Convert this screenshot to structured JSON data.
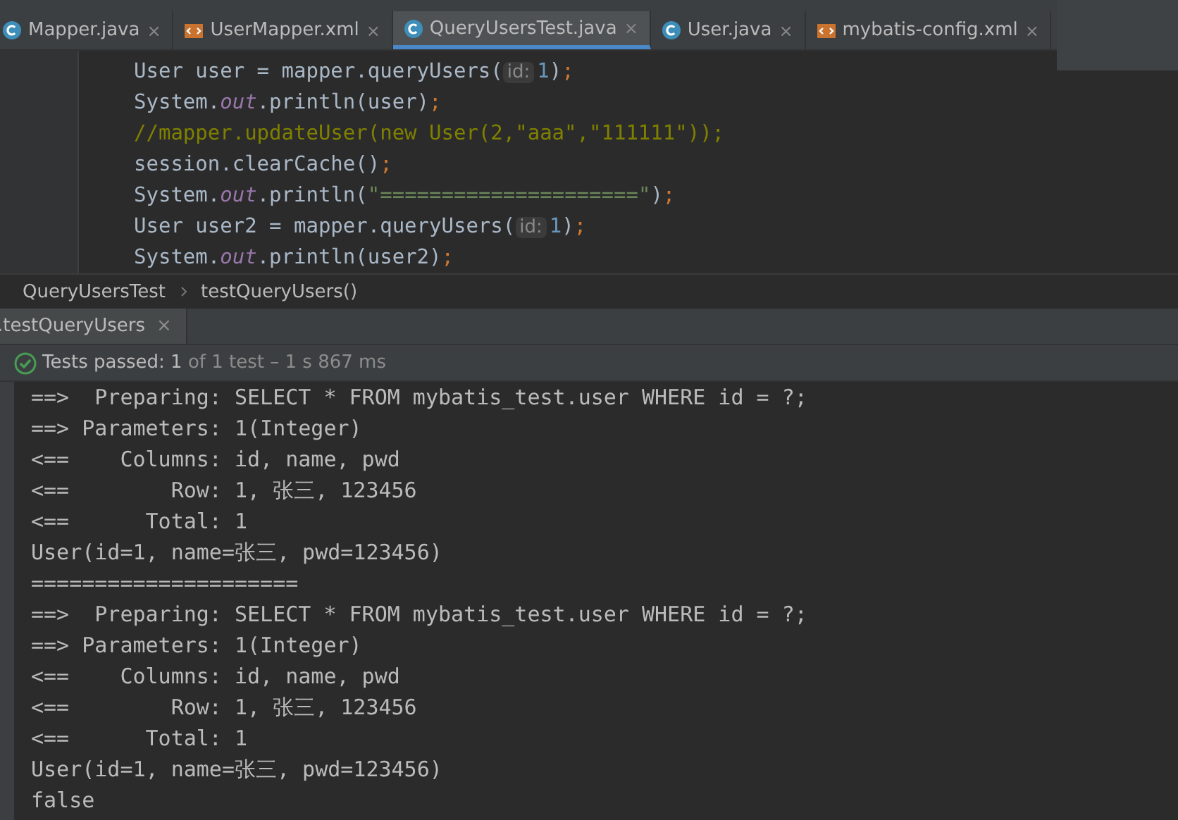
{
  "editor_tabs": [
    {
      "label": "Mapper.java",
      "kind": "class",
      "close": "×",
      "selected": false
    },
    {
      "label": "UserMapper.xml",
      "kind": "xml",
      "close": "×",
      "selected": false
    },
    {
      "label": "QueryUsersTest.java",
      "kind": "class",
      "close": "×",
      "selected": true
    },
    {
      "label": "User.java",
      "kind": "class",
      "close": "×",
      "selected": false
    },
    {
      "label": "mybatis-config.xml",
      "kind": "xml",
      "close": "×",
      "selected": false
    }
  ],
  "code_lines": [
    [
      {
        "kind": "plain",
        "text": "User user = mapper.queryUsers("
      },
      {
        "kind": "hint",
        "text": "id:"
      },
      {
        "kind": "number",
        "text": "1"
      },
      {
        "kind": "plain",
        "text": ")"
      },
      {
        "kind": "punct",
        "text": ";"
      }
    ],
    [
      {
        "kind": "plain",
        "text": "System."
      },
      {
        "kind": "field",
        "text": "out"
      },
      {
        "kind": "plain",
        "text": ".println(user)"
      },
      {
        "kind": "punct",
        "text": ";"
      }
    ],
    [
      {
        "kind": "comment",
        "text": "//mapper.updateUser(new User(2,\"aaa\",\"111111\"));"
      }
    ],
    [
      {
        "kind": "plain",
        "text": "session.clearCache()"
      },
      {
        "kind": "punct",
        "text": ";"
      }
    ],
    [
      {
        "kind": "plain",
        "text": "System."
      },
      {
        "kind": "field",
        "text": "out"
      },
      {
        "kind": "plain",
        "text": ".println("
      },
      {
        "kind": "string",
        "text": "\"=====================\""
      },
      {
        "kind": "plain",
        "text": ")"
      },
      {
        "kind": "punct",
        "text": ";"
      }
    ],
    [
      {
        "kind": "plain",
        "text": "User user2 = mapper.queryUsers("
      },
      {
        "kind": "hint",
        "text": "id:"
      },
      {
        "kind": "number",
        "text": "1"
      },
      {
        "kind": "plain",
        "text": ")"
      },
      {
        "kind": "punct",
        "text": ";"
      }
    ],
    [
      {
        "kind": "plain",
        "text": "System."
      },
      {
        "kind": "field",
        "text": "out"
      },
      {
        "kind": "plain",
        "text": ".println(user2)"
      },
      {
        "kind": "punct",
        "text": ";"
      }
    ]
  ],
  "breadcrumb": [
    "QueryUsersTest",
    "testQueryUsers()"
  ],
  "run_tab": {
    "label": ".testQueryUsers",
    "close": "×"
  },
  "status": {
    "label": "Tests passed:",
    "passed": "1",
    "rest": "of 1 test",
    "duration": "– 1 s 867 ms"
  },
  "console_lines": [
    "==>  Preparing: SELECT * FROM mybatis_test.user WHERE id = ?;",
    "==> Parameters: 1(Integer)",
    "<==    Columns: id, name, pwd",
    "<==        Row: 1, 张三, 123456",
    "<==      Total: 1",
    "User(id=1, name=张三, pwd=123456)",
    "=====================",
    "==>  Preparing: SELECT * FROM mybatis_test.user WHERE id = ?;",
    "==> Parameters: 1(Integer)",
    "<==    Columns: id, name, pwd",
    "<==        Row: 1, 张三, 123456",
    "<==      Total: 1",
    "User(id=1, name=张三, pwd=123456)",
    "false"
  ]
}
